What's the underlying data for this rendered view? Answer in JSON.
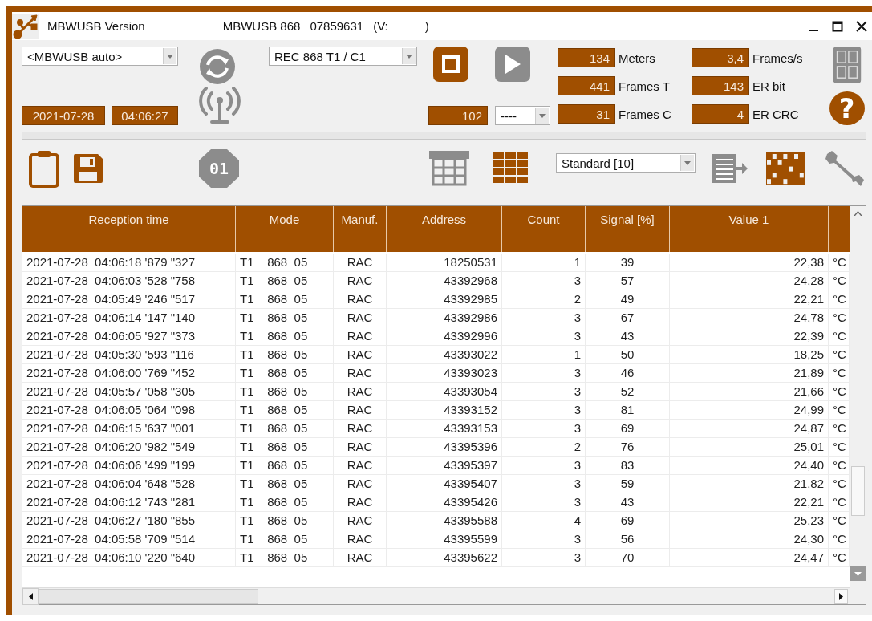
{
  "window": {
    "title": "MBWUSB Version",
    "device": [
      "MBWUSB 868",
      "07859631",
      "(V:",
      ")"
    ]
  },
  "controls": {
    "port_select": {
      "value": "<MBWUSB auto>"
    },
    "mode_select": {
      "value": "REC 868 T1 / C1"
    },
    "date": "2021-07-28",
    "time": "04:06:27",
    "channel_value": "102",
    "channel_select": {
      "value": "----"
    },
    "stop_button": {
      "disabled": false
    },
    "play_button": {
      "disabled": true
    },
    "help_button": {
      "label": "?"
    },
    "stats": [
      {
        "value": "134",
        "label": "Meters"
      },
      {
        "value": "3,4",
        "label": "Frames/s"
      },
      {
        "value": "441",
        "label": "Frames T"
      },
      {
        "value": "143",
        "label": "ER bit"
      },
      {
        "value": "31",
        "label": "Frames C"
      },
      {
        "value": "4",
        "label": "ER CRC"
      }
    ]
  },
  "toolbar": {
    "octagon_button": {
      "label": "01"
    },
    "view_select": {
      "value": "Standard [10]"
    }
  },
  "table": {
    "columns": [
      "Reception time",
      "Mode",
      "Manuf.",
      "Address",
      "Count",
      "Signal [%]",
      "Value 1"
    ],
    "rows": [
      [
        "2021-07-28  04:06:18 '879 \"327",
        "T1    868  05",
        "RAC",
        "18250531",
        "1",
        "39",
        "22,38",
        "°C"
      ],
      [
        "2021-07-28  04:06:03 '528 \"758",
        "T1    868  05",
        "RAC",
        "43392968",
        "3",
        "57",
        "24,28",
        "°C"
      ],
      [
        "2021-07-28  04:05:49 '246 \"517",
        "T1    868  05",
        "RAC",
        "43392985",
        "2",
        "49",
        "22,21",
        "°C"
      ],
      [
        "2021-07-28  04:06:14 '147 \"140",
        "T1    868  05",
        "RAC",
        "43392986",
        "3",
        "67",
        "24,78",
        "°C"
      ],
      [
        "2021-07-28  04:06:05 '927 \"373",
        "T1    868  05",
        "RAC",
        "43392996",
        "3",
        "43",
        "22,39",
        "°C"
      ],
      [
        "2021-07-28  04:05:30 '593 \"116",
        "T1    868  05",
        "RAC",
        "43393022",
        "1",
        "50",
        "18,25",
        "°C"
      ],
      [
        "2021-07-28  04:06:00 '769 \"452",
        "T1    868  05",
        "RAC",
        "43393023",
        "3",
        "46",
        "21,89",
        "°C"
      ],
      [
        "2021-07-28  04:05:57 '058 \"305",
        "T1    868  05",
        "RAC",
        "43393054",
        "3",
        "52",
        "21,66",
        "°C"
      ],
      [
        "2021-07-28  04:06:05 '064 \"098",
        "T1    868  05",
        "RAC",
        "43393152",
        "3",
        "81",
        "24,99",
        "°C"
      ],
      [
        "2021-07-28  04:06:15 '637 \"001",
        "T1    868  05",
        "RAC",
        "43393153",
        "3",
        "69",
        "24,87",
        "°C"
      ],
      [
        "2021-07-28  04:06:20 '982 \"549",
        "T1    868  05",
        "RAC",
        "43395396",
        "2",
        "76",
        "25,01",
        "°C"
      ],
      [
        "2021-07-28  04:06:06 '499 \"199",
        "T1    868  05",
        "RAC",
        "43395397",
        "3",
        "83",
        "24,40",
        "°C"
      ],
      [
        "2021-07-28  04:06:04 '648 \"528",
        "T1    868  05",
        "RAC",
        "43395407",
        "3",
        "59",
        "21,82",
        "°C"
      ],
      [
        "2021-07-28  04:06:12 '743 \"281",
        "T1    868  05",
        "RAC",
        "43395426",
        "3",
        "43",
        "22,21",
        "°C"
      ],
      [
        "2021-07-28  04:06:27 '180 \"855",
        "T1    868  05",
        "RAC",
        "43395588",
        "4",
        "69",
        "25,23",
        "°C"
      ],
      [
        "2021-07-28  04:05:58 '709 \"514",
        "T1    868  05",
        "RAC",
        "43395599",
        "3",
        "56",
        "24,30",
        "°C"
      ],
      [
        "2021-07-28  04:06:10 '220 \"640",
        "T1    868  05",
        "RAC",
        "43395622",
        "3",
        "70",
        "24,47",
        "°C"
      ]
    ]
  }
}
